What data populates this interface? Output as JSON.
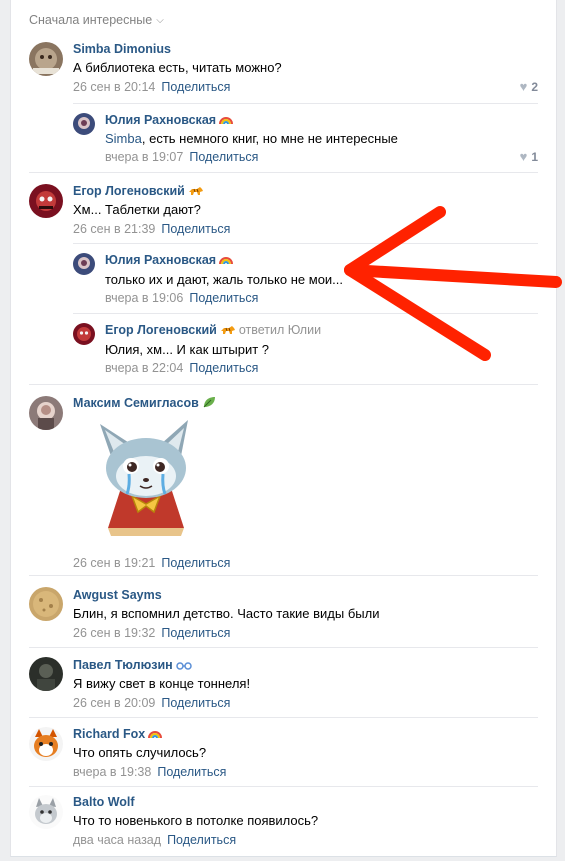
{
  "sort": {
    "label": "Сначала интересные"
  },
  "comments": [
    {
      "name": "Simba Dimonius",
      "text": "А библиотека есть, читать можно?",
      "date": "26 сен в 20:14",
      "share": "Поделиться",
      "likes": "2"
    },
    {
      "name": "Юлия Рахновская",
      "mention": "Simba",
      "text": ", есть немного книг, но мне не интересные",
      "date": "вчера в 19:07",
      "share": "Поделиться",
      "likes": "1"
    },
    {
      "name": "Егор Логеновский",
      "text": "Хм... Таблетки дают?",
      "date": "26 сен в 21:39",
      "share": "Поделиться"
    },
    {
      "name": "Юлия Рахновская",
      "text": "только их и дают, жаль только не мои...",
      "date": "вчера в 19:06",
      "share": "Поделиться"
    },
    {
      "name": "Егор Логеновский",
      "replied": "ответил Юлии",
      "text": "Юлия, хм... И как штырит ?",
      "date": "вчера в 22:04",
      "share": "Поделиться"
    },
    {
      "name": "Максим Семигласов",
      "date": "26 сен в 19:21",
      "share": "Поделиться"
    },
    {
      "name": "Awgust Sayms",
      "text": "Блин, я вспомнил детство. Часто такие виды были",
      "date": "26 сен в 19:32",
      "share": "Поделиться"
    },
    {
      "name": "Павел Тюлюзин",
      "text": "Я вижу свет в конце тоннеля!",
      "date": "26 сен в 20:09",
      "share": "Поделиться"
    },
    {
      "name": "Richard Fox",
      "text": "Что опять случилось?",
      "date": "вчера в 19:38",
      "share": "Поделиться"
    },
    {
      "name": "Balto Wolf",
      "text": "Что то новенького в потолке появилось?",
      "date": "два часа назад",
      "share": "Поделиться"
    }
  ],
  "colors": {
    "link": "#2a5885",
    "meta": "#939393",
    "annotation": "#ff2200"
  }
}
